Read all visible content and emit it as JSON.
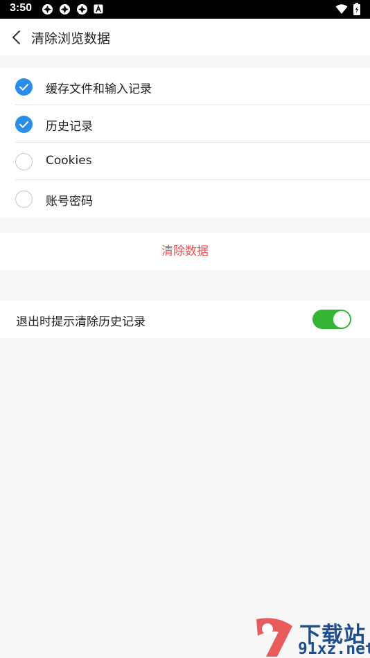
{
  "status_bar": {
    "time": "3:50",
    "icons": [
      "sync-icon",
      "sync-icon",
      "sync-icon",
      "a-icon"
    ],
    "right_icons": [
      "wifi-icon",
      "battery-icon"
    ]
  },
  "header": {
    "title": "清除浏览数据"
  },
  "options": [
    {
      "label": "缓存文件和输入记录",
      "checked": true
    },
    {
      "label": "历史记录",
      "checked": true
    },
    {
      "label": "Cookies",
      "checked": false
    },
    {
      "label": "账号密码",
      "checked": false
    }
  ],
  "clear_button": {
    "label": "清除数据"
  },
  "setting": {
    "label": "退出时提示清除历史记录",
    "enabled": true
  },
  "watermark": {
    "line1": "下载站",
    "line2": "91xz.net"
  },
  "colors": {
    "accent": "#2a8ee8",
    "danger": "#ef4d4d",
    "toggle_on": "#34b533"
  }
}
